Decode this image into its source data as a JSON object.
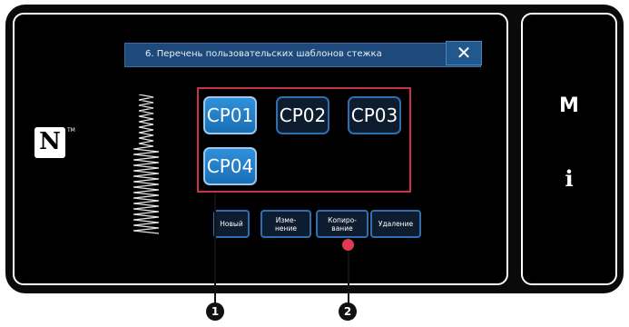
{
  "dialog": {
    "title": "6. Перечень пользовательских шаблонов стежка",
    "close_label": "✕"
  },
  "nfc": {
    "icon": "N",
    "tm": "TM"
  },
  "patterns": [
    {
      "label": "CP01",
      "selected": true
    },
    {
      "label": "CP02",
      "selected": false
    },
    {
      "label": "CP03",
      "selected": false
    },
    {
      "label": "CP04",
      "selected": true
    }
  ],
  "functions": {
    "new": "Новый",
    "edit_1": "Изме-",
    "edit_2": "нение",
    "copy_1": "Копиро-",
    "copy_2": "вание",
    "delete": "Удаление"
  },
  "side": {
    "menu_label": "M",
    "info_label": "i"
  },
  "callouts": {
    "one": "1",
    "two": "2"
  },
  "colors": {
    "highlight": "#c7344a",
    "selected_button": "#1a6fb6",
    "title_bar": "#1d4a7a"
  }
}
